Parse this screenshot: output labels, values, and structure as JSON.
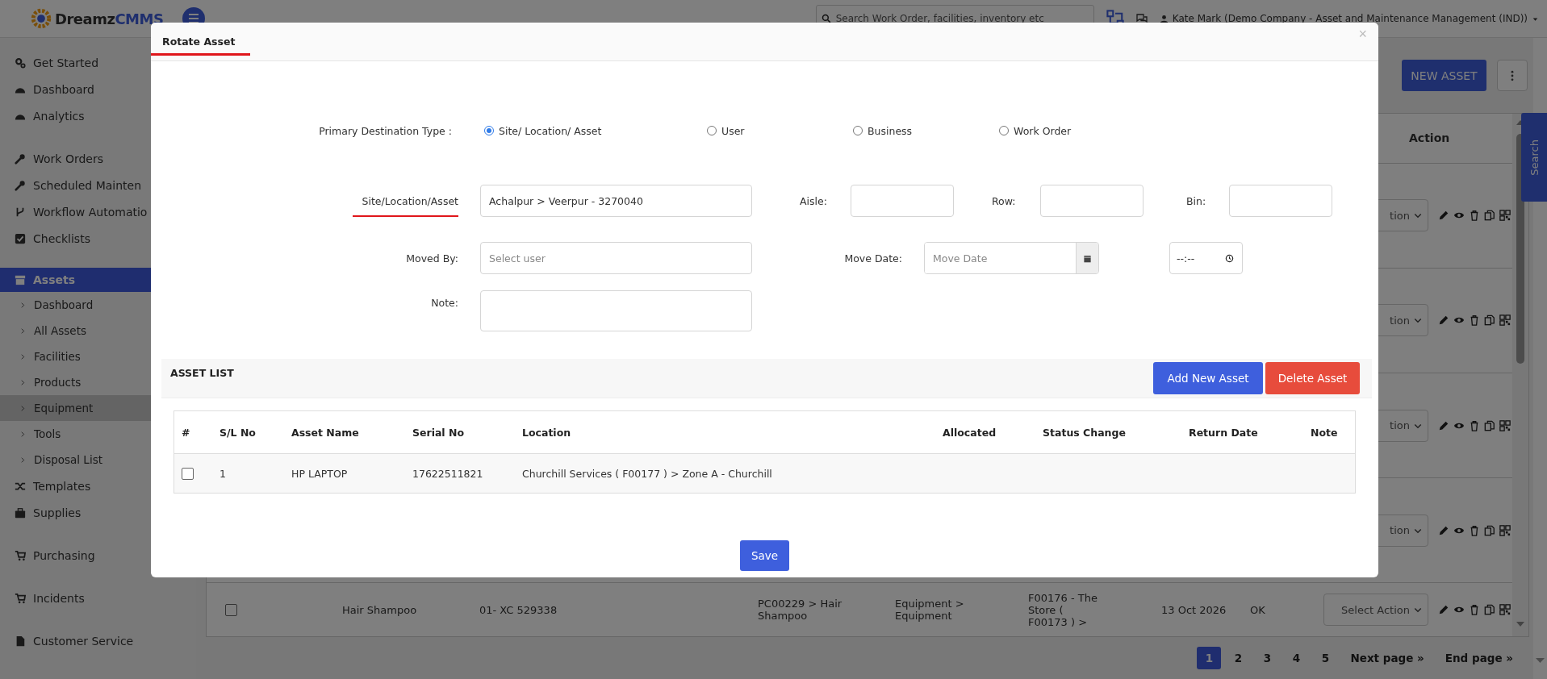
{
  "header": {
    "logo_main": "Dreamz",
    "logo_accent": "CMMS",
    "search": {
      "placeholder": "Search Work Order, facilities, inventory etc"
    },
    "user": "Kate Mark (Demo Company - Asset and Maintenance Management (IND))"
  },
  "sidebar": {
    "groups": [
      {
        "items": [
          {
            "label": "Get Started",
            "selected": false
          },
          {
            "label": "Dashboard",
            "selected": false
          },
          {
            "label": "Analytics",
            "selected": false
          }
        ]
      },
      {
        "items": [
          {
            "label": "Work Orders",
            "selected": false
          },
          {
            "label": "Scheduled Mainten",
            "selected": false
          },
          {
            "label": "Workflow Automatio",
            "selected": false
          },
          {
            "label": "Checklists",
            "selected": false
          }
        ]
      },
      {
        "items": [
          {
            "label": "Assets",
            "selected": true,
            "children": [
              {
                "label": "Dashboard",
                "highlighted": false
              },
              {
                "label": "All Assets",
                "highlighted": false
              },
              {
                "label": "Facilities",
                "highlighted": false
              },
              {
                "label": "Products",
                "highlighted": false
              },
              {
                "label": "Equipment",
                "highlighted": true
              },
              {
                "label": "Tools",
                "highlighted": false
              },
              {
                "label": "Disposal List",
                "highlighted": false
              }
            ]
          },
          {
            "label": "Templates",
            "selected": false
          },
          {
            "label": "Supplies",
            "selected": false
          }
        ]
      },
      {
        "items": [
          {
            "label": "Purchasing",
            "selected": false
          }
        ]
      },
      {
        "items": [
          {
            "label": "Incidents",
            "selected": false
          }
        ]
      },
      {
        "items": [
          {
            "label": "Customer Service",
            "selected": false
          }
        ]
      }
    ]
  },
  "toolbar": {
    "new_asset_button": "NEW ASSET"
  },
  "side_tab": "Search",
  "background_table": {
    "action_header": "Action",
    "rows": [
      {
        "kind": "partial",
        "action": "tion"
      },
      {
        "kind": "partial",
        "action": "tion"
      },
      {
        "kind": "partial",
        "action": "tion"
      },
      {
        "kind": "partial",
        "action": "tion"
      },
      {
        "kind": "full",
        "checked": false,
        "cells": [
          "Hair Shampoo",
          "01- XC 529338",
          "PC00229 > Hair Shampoo",
          "Equipment > Equipment",
          "F00176 - The Store ( F00173 ) >",
          "13 Oct 2026",
          "OK"
        ],
        "action": "Select Action"
      }
    ]
  },
  "pagination": {
    "pages": [
      {
        "label": "1",
        "selected": true
      },
      {
        "label": "2",
        "selected": false
      },
      {
        "label": "3",
        "selected": false
      },
      {
        "label": "4",
        "selected": false
      },
      {
        "label": "5",
        "selected": false
      }
    ],
    "next": "Next page »",
    "end": "End page »"
  },
  "modal": {
    "title": "Rotate Asset",
    "close": "×",
    "destination": {
      "label": "Primary Destination Type :",
      "options": [
        {
          "label": "Site/ Location/ Asset",
          "selected": true
        },
        {
          "label": "User",
          "selected": false
        },
        {
          "label": "Business",
          "selected": false
        },
        {
          "label": "Work Order",
          "selected": false
        }
      ]
    },
    "site": {
      "label": "Site/Location/Asset",
      "value": "Achalpur > Veerpur - 3270040"
    },
    "aisle": {
      "label": "Aisle:"
    },
    "row": {
      "label": "Row:"
    },
    "bin": {
      "label": "Bin:"
    },
    "moved_by": {
      "label": "Moved By:",
      "placeholder": "Select user"
    },
    "move_date": {
      "label": "Move Date:",
      "placeholder": "Move Date"
    },
    "move_time": {
      "value": "--:--"
    },
    "note": {
      "label": "Note:"
    },
    "asset_list": {
      "title": "ASSET LIST",
      "add_button": "Add New Asset",
      "delete_button": "Delete Asset",
      "columns": [
        "#",
        "S/L No",
        "Asset Name",
        "Serial No",
        "Location",
        "Allocated",
        "Status Change",
        "Return Date",
        "Note"
      ],
      "rows": [
        {
          "checked": false,
          "sl_no": "1",
          "asset_name": "HP LAPTOP",
          "serial_no": "17622511821",
          "location": "Churchill Services ( F00177 ) > Zone A - Churchill"
        }
      ]
    },
    "save_button": "Save"
  }
}
